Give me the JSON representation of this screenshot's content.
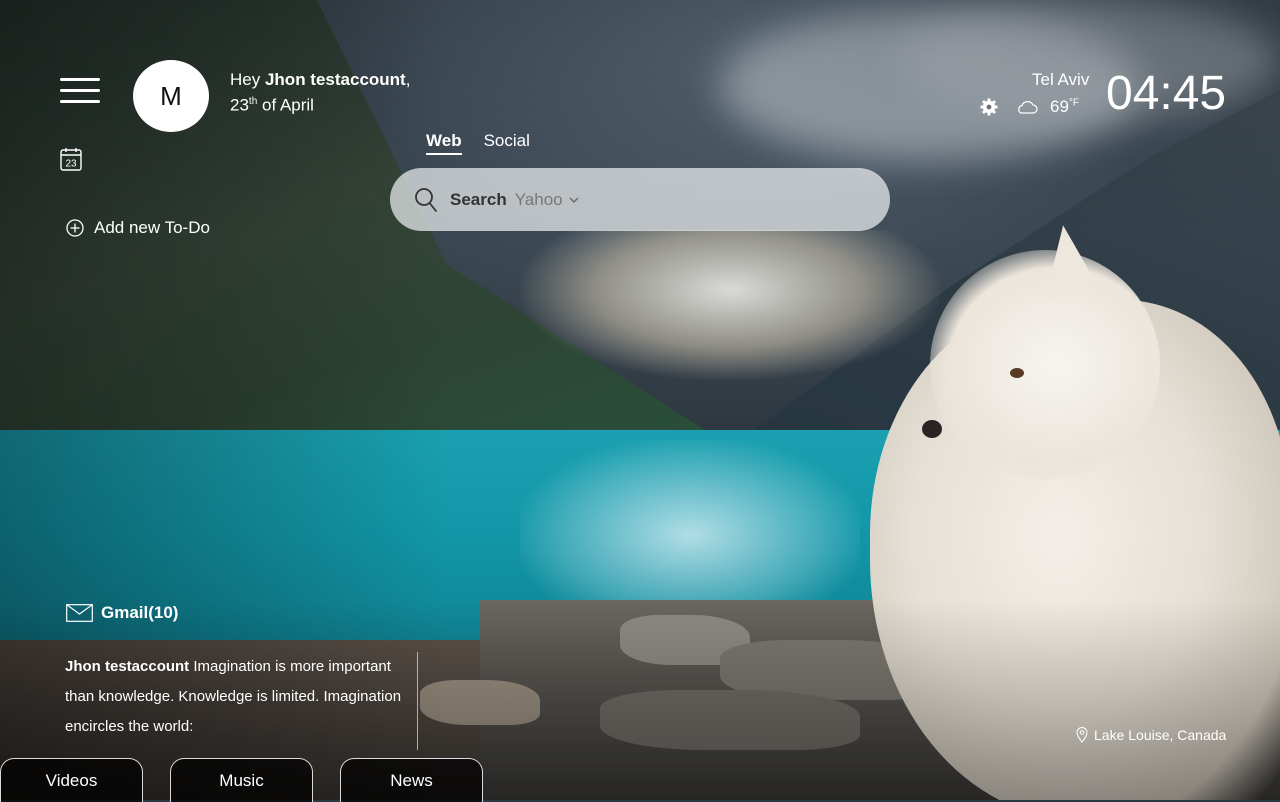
{
  "user": {
    "initial": "M",
    "greeting_prefix": "Hey ",
    "name": "Jhon testaccount",
    "name_suffix": ",",
    "date_day": "23",
    "date_ordinal": "th",
    "date_rest": " of April"
  },
  "todo": {
    "add_label": "Add new To-Do"
  },
  "calendar": {
    "day": "23"
  },
  "search": {
    "tabs": [
      {
        "label": "Web",
        "active": true
      },
      {
        "label": "Social",
        "active": false
      }
    ],
    "label": "Search",
    "engine": "Yahoo"
  },
  "weather": {
    "city": "Tel Aviv",
    "temp": "69",
    "unit": "°F",
    "condition_icon": "cloud-icon"
  },
  "clock": {
    "time": "04:45"
  },
  "gmail": {
    "label": "Gmail(10)",
    "preview_sender": "Jhon testaccount",
    "preview_text": " Imagination is more important than knowledge. Knowledge is limited. Imagination encircles the world:"
  },
  "photo": {
    "location": "Lake Louise, Canada"
  },
  "bottom_tabs": [
    {
      "label": "Videos"
    },
    {
      "label": "Music"
    },
    {
      "label": "News"
    }
  ]
}
